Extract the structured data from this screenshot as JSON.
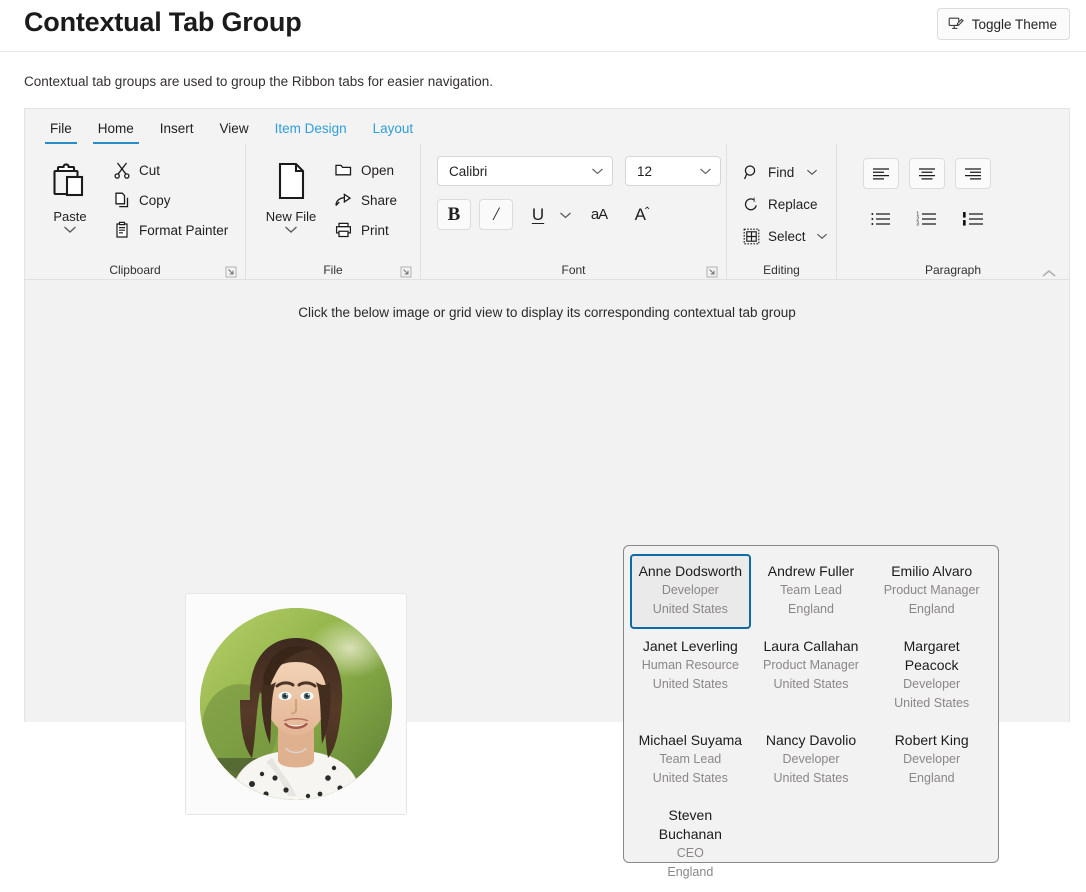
{
  "header": {
    "title": "Contextual Tab Group",
    "toggle_theme_label": "Toggle Theme",
    "toggle_theme_icon": "theme-edit-icon"
  },
  "description": "Contextual tab groups are used to group the Ribbon tabs for easier navigation.",
  "ribbon": {
    "tabs": [
      {
        "label": "File",
        "active": false,
        "contextual": false
      },
      {
        "label": "Home",
        "active": true,
        "contextual": false
      },
      {
        "label": "Insert",
        "active": false,
        "contextual": false
      },
      {
        "label": "View",
        "active": false,
        "contextual": false
      },
      {
        "label": "Item Design",
        "active": false,
        "contextual": true
      },
      {
        "label": "Layout",
        "active": false,
        "contextual": true
      }
    ],
    "contextual_color": "#2f9fd8",
    "active_underline_color": "#2a8cc7",
    "groups": {
      "clipboard": {
        "label": "Clipboard",
        "big_button": {
          "label": "Paste",
          "icon": "clipboard-paste-icon",
          "has_dropdown": true
        },
        "items": [
          {
            "label": "Cut",
            "icon": "scissors-icon"
          },
          {
            "label": "Copy",
            "icon": "copy-icon"
          },
          {
            "label": "Format Painter",
            "icon": "format-painter-icon"
          }
        ],
        "has_launcher": true
      },
      "file": {
        "label": "File",
        "big_button": {
          "label": "New File",
          "icon": "new-file-icon",
          "has_dropdown": true
        },
        "items": [
          {
            "label": "Open",
            "icon": "folder-open-icon"
          },
          {
            "label": "Share",
            "icon": "share-icon"
          },
          {
            "label": "Print",
            "icon": "printer-icon"
          }
        ],
        "has_launcher": true
      },
      "font": {
        "label": "Font",
        "font_name": {
          "value": "Calibri",
          "icon": "chevron-down-icon"
        },
        "font_size": {
          "value": "12",
          "icon": "chevron-down-icon"
        },
        "buttons": [
          {
            "name": "bold",
            "glyph": "B",
            "icon": "bold-icon",
            "boxed": true
          },
          {
            "name": "italic",
            "glyph": "I",
            "icon": "italic-icon",
            "boxed": true
          },
          {
            "name": "underline",
            "glyph": "U",
            "icon": "underline-icon",
            "boxed": false,
            "has_dropdown": true
          },
          {
            "name": "change-case",
            "glyph": "aA",
            "icon": "change-case-icon",
            "boxed": false
          },
          {
            "name": "grow-font",
            "glyph": "A",
            "icon": "grow-font-icon",
            "boxed": false
          }
        ],
        "has_launcher": true
      },
      "editing": {
        "label": "Editing",
        "items": [
          {
            "label": "Find",
            "icon": "search-icon",
            "has_dropdown": true
          },
          {
            "label": "Replace",
            "icon": "replace-icon",
            "has_dropdown": false
          },
          {
            "label": "Select",
            "icon": "select-grid-icon",
            "has_dropdown": true
          }
        ]
      },
      "paragraph": {
        "label": "Paragraph",
        "row1": [
          {
            "name": "align-left",
            "icon": "align-left-icon",
            "boxed": true
          },
          {
            "name": "align-center",
            "icon": "align-center-icon",
            "boxed": true
          },
          {
            "name": "align-right",
            "icon": "align-right-icon",
            "boxed": true
          }
        ],
        "row2": [
          {
            "name": "bullet-list",
            "icon": "bullet-list-icon",
            "boxed": false
          },
          {
            "name": "numbered-list",
            "icon": "numbered-list-icon",
            "boxed": false
          },
          {
            "name": "multilevel-list",
            "icon": "multilevel-list-icon",
            "boxed": false
          }
        ],
        "collapse_icon": "chevron-up-icon"
      }
    }
  },
  "content": {
    "hint": "Click the below image or grid view to display its corresponding contextual tab group",
    "image_card": {
      "icon": "employee-photo",
      "alt": "Employee portrait photo"
    },
    "grid": {
      "selected_index": 0,
      "selected_border_color": "#0e6ba8",
      "employees": [
        {
          "name": "Anne Dodsworth",
          "role": "Developer",
          "country": "United States"
        },
        {
          "name": "Andrew Fuller",
          "role": "Team Lead",
          "country": "England"
        },
        {
          "name": "Emilio Alvaro",
          "role": "Product Manager",
          "country": "England"
        },
        {
          "name": "Janet Leverling",
          "role": "Human Resource",
          "country": "United States"
        },
        {
          "name": "Laura Callahan",
          "role": "Product Manager",
          "country": "United States"
        },
        {
          "name": "Margaret Peacock",
          "role": "Developer",
          "country": "United States"
        },
        {
          "name": "Michael Suyama",
          "role": "Team Lead",
          "country": "United States"
        },
        {
          "name": "Nancy Davolio",
          "role": "Developer",
          "country": "United States"
        },
        {
          "name": "Robert King",
          "role": "Developer",
          "country": "England"
        },
        {
          "name": "Steven Buchanan",
          "role": "CEO",
          "country": "England"
        }
      ]
    }
  }
}
